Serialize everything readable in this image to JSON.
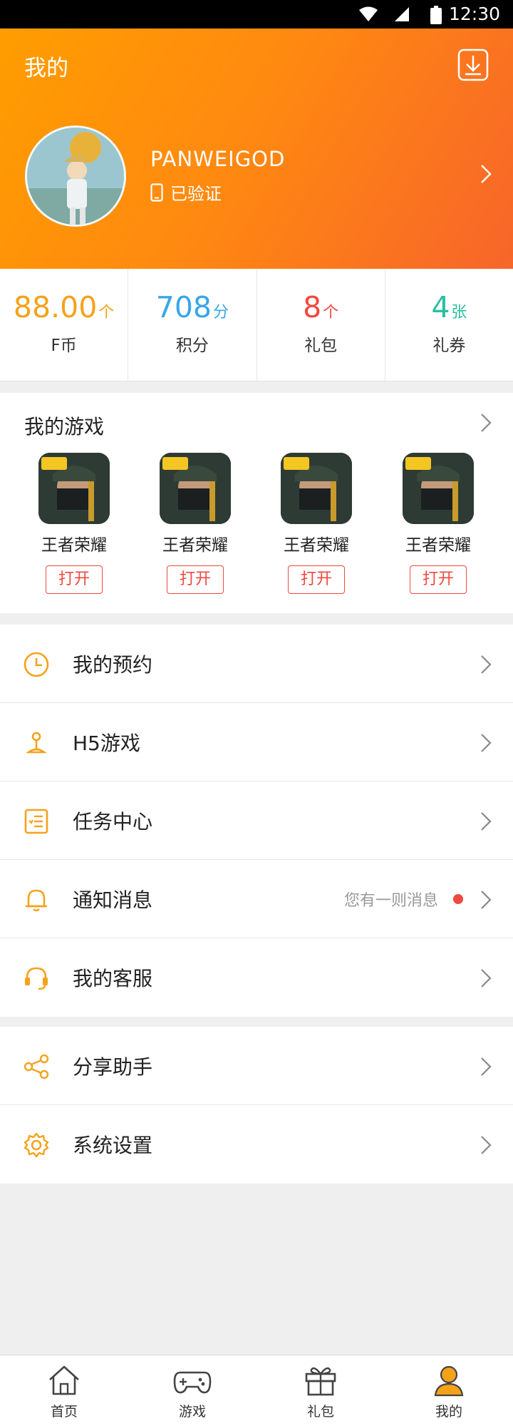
{
  "status_bar": {
    "time": "12:30"
  },
  "header": {
    "title": "我的",
    "username": "PANWEIGOD",
    "verified_text": "已验证"
  },
  "stats": [
    {
      "value": "88.00",
      "unit": "个",
      "label": "F币",
      "color": "#f5a21b"
    },
    {
      "value": "708",
      "unit": "分",
      "label": "积分",
      "color": "#3aa6e8"
    },
    {
      "value": "8",
      "unit": "个",
      "label": "礼包",
      "color": "#f0493f"
    },
    {
      "value": "4",
      "unit": "张",
      "label": "礼券",
      "color": "#2bbfa2"
    }
  ],
  "my_games": {
    "title": "我的游戏",
    "games": [
      {
        "name": "王者荣耀",
        "button": "打开"
      },
      {
        "name": "王者荣耀",
        "button": "打开"
      },
      {
        "name": "王者荣耀",
        "button": "打开"
      },
      {
        "name": "王者荣耀",
        "button": "打开"
      }
    ]
  },
  "menu_1": [
    {
      "label": "我的预约",
      "icon": "clock-icon"
    },
    {
      "label": "H5游戏",
      "icon": "joystick-icon"
    },
    {
      "label": "任务中心",
      "icon": "task-icon"
    },
    {
      "label": "通知消息",
      "icon": "bell-icon",
      "extra": "您有一则消息"
    },
    {
      "label": "我的客服",
      "icon": "headset-icon"
    }
  ],
  "menu_2": [
    {
      "label": "分享助手",
      "icon": "share-icon"
    },
    {
      "label": "系统设置",
      "icon": "gear-icon"
    }
  ],
  "tabbar": [
    {
      "label": "首页",
      "icon": "home-icon"
    },
    {
      "label": "游戏",
      "icon": "gamepad-icon"
    },
    {
      "label": "礼包",
      "icon": "gift-icon"
    },
    {
      "label": "我的",
      "icon": "user-icon",
      "active": true
    }
  ],
  "colors": {
    "accent": "#ff9d00",
    "accent_end": "#f7652a",
    "alert": "#f0493f"
  }
}
